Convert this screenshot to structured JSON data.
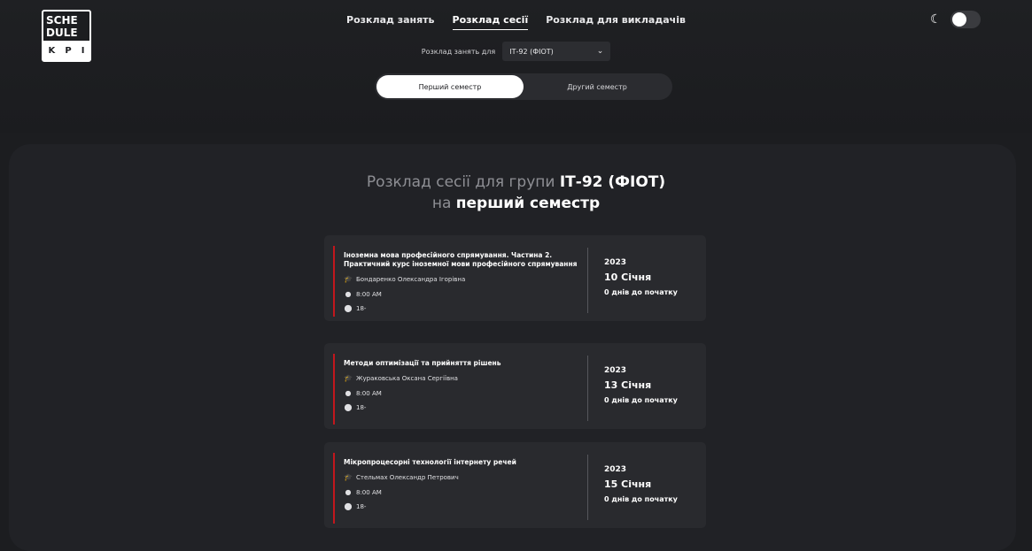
{
  "logo": {
    "line1": "SCHE",
    "line2": "DULE",
    "bar": [
      "K",
      "P",
      "I"
    ]
  },
  "nav": [
    {
      "label": "Розклад занять"
    },
    {
      "label": "Розклад сесії"
    },
    {
      "label": "Розклад для викладачів"
    }
  ],
  "group": {
    "label": "Розклад занять для",
    "selected": "ІТ-92 (ФІОТ)"
  },
  "semester": {
    "first": "Перший семестр",
    "second": "Другий семестр"
  },
  "heading": {
    "prefix": "Розклад сесії для групи",
    "group": "ІТ-92 (ФІОТ)",
    "on": "на",
    "semester": "перший семестр"
  },
  "exams": [
    {
      "subject": "Іноземна мова професійного спрямування. Частина 2. Практичний курс іноземної мови професійного спрямування",
      "teacher": "Бондаренко Олександра Ігорівна",
      "time": "8:00 AM",
      "room": "18-",
      "year": "2023",
      "date": "10 Січня",
      "days": "0 днів до початку"
    },
    {
      "subject": "Методи оптимізації та прийняття рішень",
      "teacher": "Жураковська Оксана Сергіївна",
      "time": "8:00 AM",
      "room": "18-",
      "year": "2023",
      "date": "13 Січня",
      "days": "0 днів до початку"
    },
    {
      "subject": "Мікропроцесорні технології інтернету речей",
      "teacher": "Стельмах Олександр Петрович",
      "time": "8:00 AM",
      "room": "18-",
      "year": "2023",
      "date": "15 Січня",
      "days": "0 днів до початку"
    }
  ]
}
